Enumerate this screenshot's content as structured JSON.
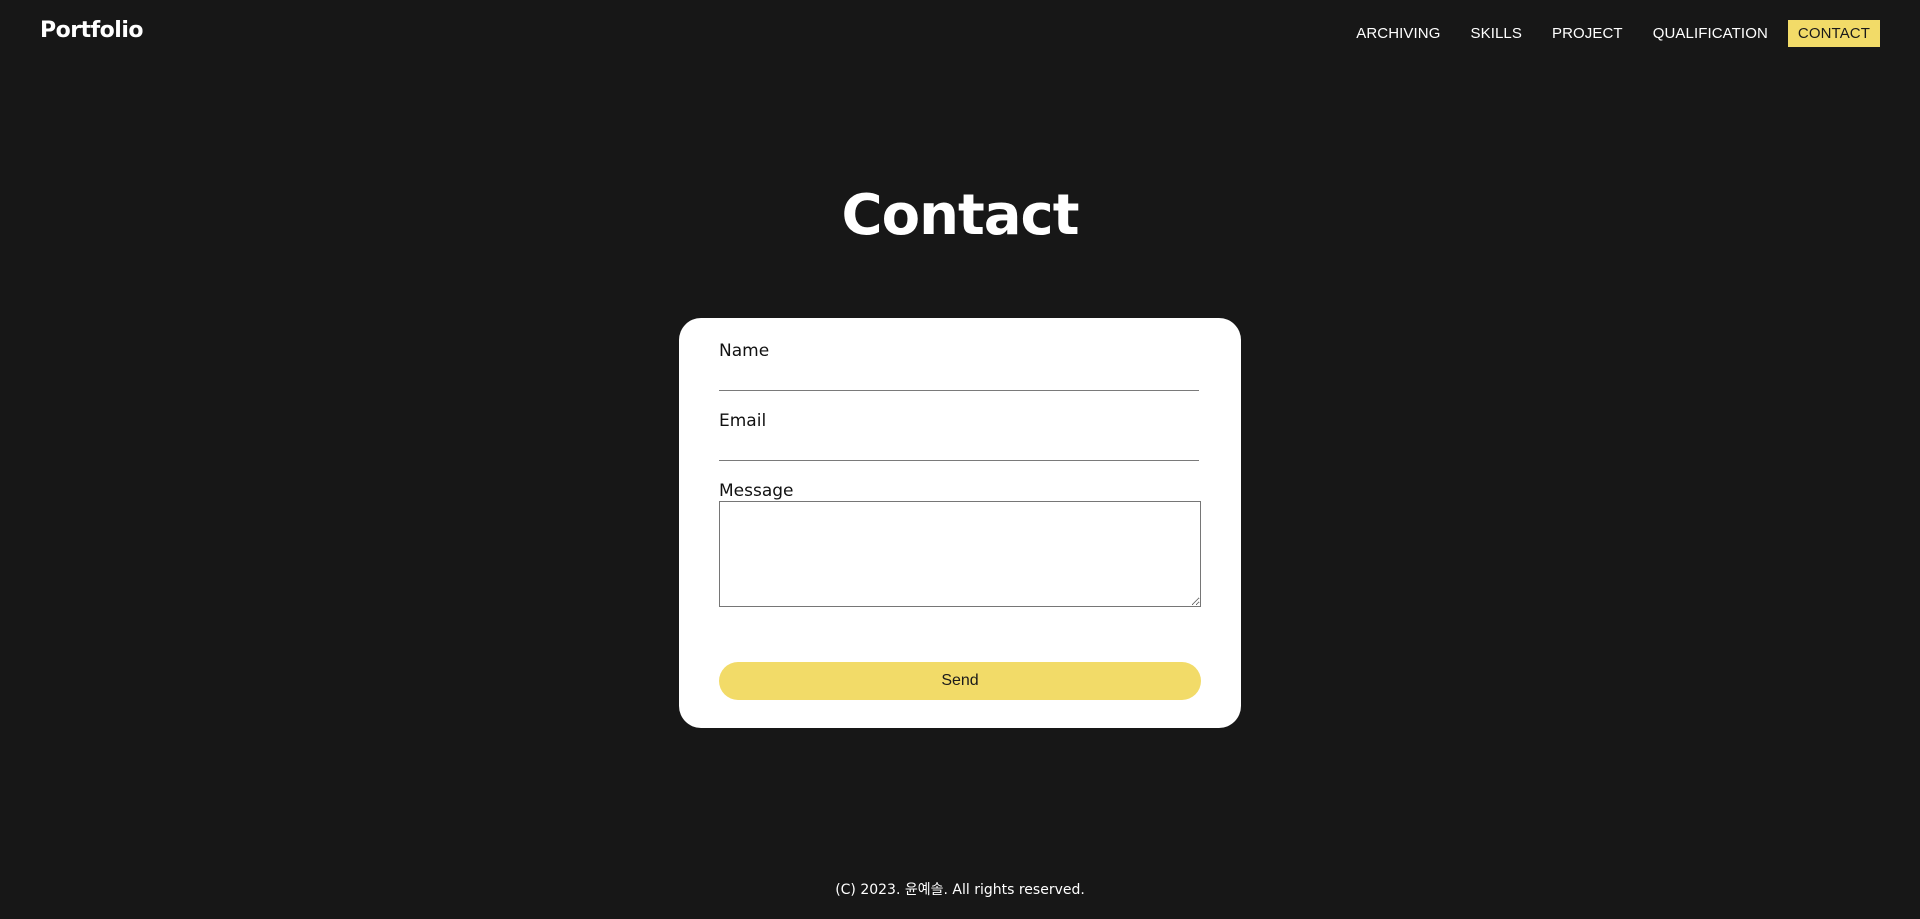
{
  "header": {
    "logo": "Portfolio",
    "nav": [
      {
        "label": "ARCHIVING",
        "active": false
      },
      {
        "label": "SKILLS",
        "active": false
      },
      {
        "label": "PROJECT",
        "active": false
      },
      {
        "label": "QUALIFICATION",
        "active": false
      },
      {
        "label": "CONTACT",
        "active": true
      }
    ]
  },
  "main": {
    "title": "Contact",
    "form": {
      "name_label": "Name",
      "name_value": "",
      "email_label": "Email",
      "email_value": "",
      "message_label": "Message",
      "message_value": "",
      "send_label": "Send"
    }
  },
  "footer": {
    "copyright": "(C) 2023. 윤예솔. All rights reserved."
  },
  "colors": {
    "background": "#171717",
    "accent": "#f2db68",
    "card": "#ffffff"
  }
}
